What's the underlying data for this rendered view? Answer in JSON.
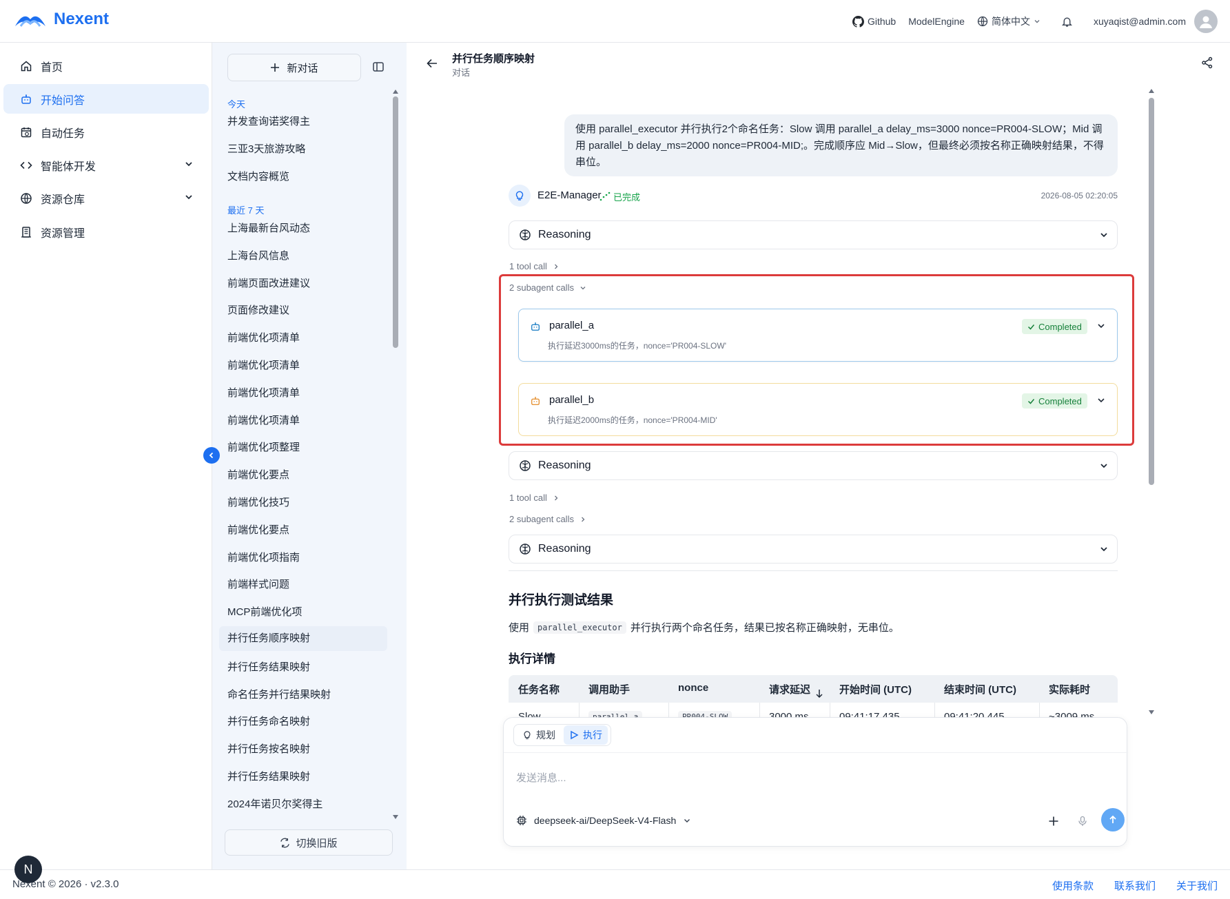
{
  "header": {
    "brand": "Nexent",
    "github": "Github",
    "model_engine": "ModelEngine",
    "language": "简体中文",
    "user_email": "xuyaqist@admin.com"
  },
  "sidebar": {
    "items": [
      {
        "label": "首页",
        "icon": "home-icon"
      },
      {
        "label": "开始问答",
        "icon": "bot-icon",
        "active": true
      },
      {
        "label": "自动任务",
        "icon": "calendar-clock-icon"
      },
      {
        "label": "智能体开发",
        "icon": "code-icon",
        "expandable": true
      },
      {
        "label": "资源仓库",
        "icon": "globe-icon",
        "expandable": true
      },
      {
        "label": "资源管理",
        "icon": "database-icon"
      }
    ]
  },
  "history": {
    "new_chat": "新对话",
    "today_label": "今天",
    "today": [
      "并发查询诺奖得主",
      "三亚3天旅游攻略",
      "文档内容概览"
    ],
    "week_label": "最近 7 天",
    "week": [
      "上海最新台风动态",
      "上海台风信息",
      "前端页面改进建议",
      "页面修改建议",
      "前端优化项清单",
      "前端优化项清单",
      "前端优化项清单",
      "前端优化项清单",
      "前端优化项整理",
      "前端优化要点",
      "前端优化技巧",
      "前端优化要点",
      "前端优化项指南",
      "前端样式问题",
      "MCP前端优化项",
      "并行任务顺序映射",
      "并行任务结果映射",
      "命名任务并行结果映射",
      "并行任务命名映射",
      "并行任务按名映射",
      "并行任务结果映射",
      "2024年诺贝尔奖得主"
    ],
    "selected_index": 15,
    "switch_old": "切换旧版"
  },
  "conversation": {
    "title": "并行任务顺序映射",
    "subtitle": "对话",
    "user_message": "使用 parallel_executor 并行执行2个命名任务：Slow 调用 parallel_a delay_ms=3000 nonce=PR004-SLOW；Mid 调用 parallel_b delay_ms=2000 nonce=PR004-MID;。完成顺序应 Mid→Slow，但最终必须按名称正确映射结果，不得串位。",
    "agent_name": "E2E-Manager",
    "agent_status": "已完成",
    "timestamp": "2026-08-05 02:20:05",
    "reasoning_label": "Reasoning",
    "tool_call_1": "1 tool call",
    "subagent_calls_1": "2 subagent calls",
    "subagents": [
      {
        "name": "parallel_a",
        "desc": "执行延迟3000ms的任务，nonce='PR004-SLOW'",
        "status": "Completed",
        "color": "#2a86c8"
      },
      {
        "name": "parallel_b",
        "desc": "执行延迟2000ms的任务，nonce='PR004-MID'",
        "status": "Completed",
        "color": "#e6953a"
      }
    ],
    "tool_call_2": "1 tool call",
    "subagent_calls_2": "2 subagent calls",
    "result_title": "并行执行测试结果",
    "result_para_pre": "使用",
    "result_code": "parallel_executor",
    "result_para_post": "并行执行两个命名任务，结果已按名称正确映射，无串位。",
    "details_title": "执行详情",
    "table": {
      "headers": [
        "任务名称",
        "调用助手",
        "nonce",
        "请求延迟",
        "开始时间 (UTC)",
        "结束时间 (UTC)",
        "实际耗时"
      ],
      "row": [
        "Slow",
        "parallel_a",
        "PR004-SLOW",
        "3000 ms",
        "09:41:17.435",
        "09:41:20.445",
        "~3009 ms"
      ]
    }
  },
  "composer": {
    "mode_plan": "规划",
    "mode_exec": "执行",
    "placeholder": "发送消息...",
    "model": "deepseek-ai/DeepSeek-V4-Flash"
  },
  "footer": {
    "copyright": "Nexent © 2026 · v2.3.0",
    "terms": "使用条款",
    "contact": "联系我们",
    "about": "关于我们",
    "badge": "N"
  },
  "colors": {
    "accent": "#1d6ff0",
    "highlight": "#dc3b3b",
    "success": "#16803a"
  }
}
